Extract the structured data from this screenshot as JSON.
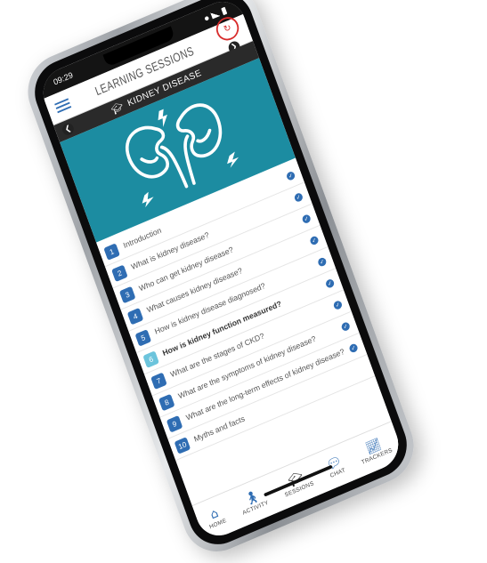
{
  "status_bar": {
    "time": "09:29"
  },
  "header": {
    "title": "LEARNING SESSIONS"
  },
  "section": {
    "title": "KIDNEY DISEASE"
  },
  "lessons": [
    {
      "num": "1",
      "title": "Introduction"
    },
    {
      "num": "2",
      "title": "What is kidney disease?"
    },
    {
      "num": "3",
      "title": "Who can get kidney disease?"
    },
    {
      "num": "4",
      "title": "What causes kidney disease?"
    },
    {
      "num": "5",
      "title": "How is kidney disease diagnosed?"
    },
    {
      "num": "6",
      "title": "How is kidney function measured?"
    },
    {
      "num": "7",
      "title": "What are the stages of CKD?"
    },
    {
      "num": "8",
      "title": "What are the symptoms of kidney disease?"
    },
    {
      "num": "9",
      "title": "What are the long-term effects of kidney disease?"
    },
    {
      "num": "10",
      "title": "Myths and facts"
    }
  ],
  "current_lesson": "6",
  "nav": [
    {
      "label": "HOME",
      "icon": "home-icon"
    },
    {
      "label": "ACTIVITY",
      "icon": "walking-person-icon"
    },
    {
      "label": "SESSIONS",
      "icon": "graduation-cap-icon"
    },
    {
      "label": "CHAT",
      "icon": "chat-bubbles-icon"
    },
    {
      "label": "TRACKERS",
      "icon": "line-chart-icon"
    }
  ],
  "colors": {
    "accent": "#2f6db3",
    "hero": "#1c8ca1",
    "current": "#6cc4dc",
    "logo": "#d82c2c"
  }
}
